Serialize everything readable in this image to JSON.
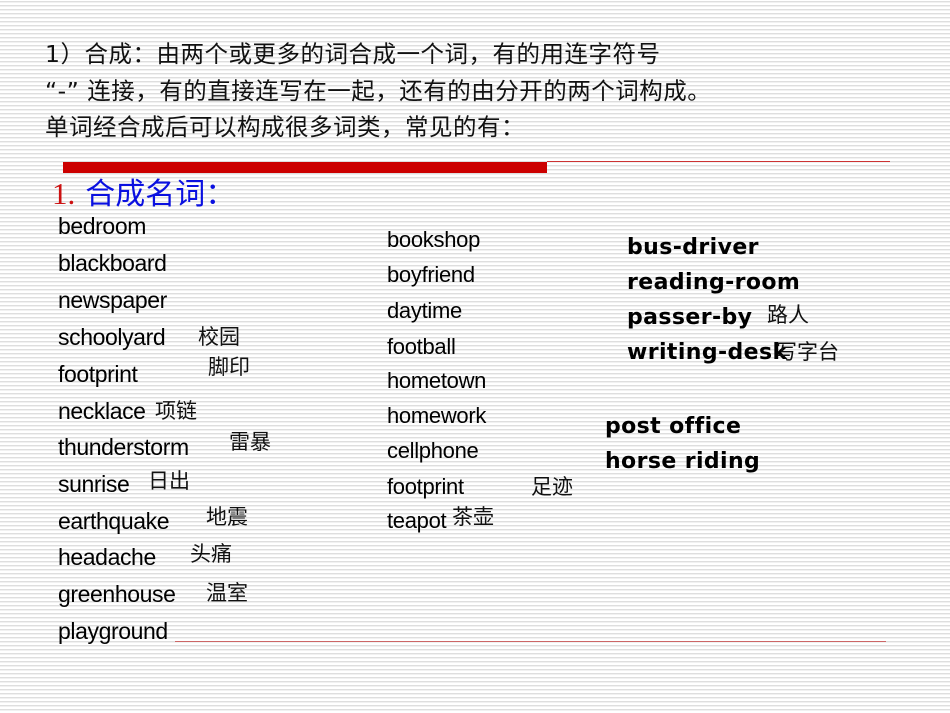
{
  "intro": {
    "line1": "1）合成：由两个或更多的词合成一个词，有的用连字符号",
    "line2": "“-” 连接，有的直接连写在一起，还有的由分开的两个词构成。",
    "line3": "单词经合成后可以构成很多词类，常见的有："
  },
  "section": {
    "number": "1.",
    "label": "合成名词："
  },
  "colors": {
    "accent_red": "#cc0000",
    "title_blue": "#0a10e0"
  },
  "column1": [
    {
      "word": "bedroom",
      "gloss": ""
    },
    {
      "word": "blackboard",
      "gloss": ""
    },
    {
      "word": "newspaper",
      "gloss": ""
    },
    {
      "word": "schoolyard",
      "gloss": "校园"
    },
    {
      "word": "footprint",
      "gloss": "脚印"
    },
    {
      "word": "necklace",
      "gloss": "项链"
    },
    {
      "word": "thunderstorm",
      "gloss": "雷暴"
    },
    {
      "word": "sunrise",
      "gloss": "日出"
    },
    {
      "word": "earthquake",
      "gloss": "地震"
    },
    {
      "word": "headache",
      "gloss": "头痛"
    },
    {
      "word": "greenhouse",
      "gloss": "温室"
    },
    {
      "word": "playground",
      "gloss": ""
    }
  ],
  "column2": [
    {
      "word": "bookshop",
      "gloss": ""
    },
    {
      "word": "boyfriend",
      "gloss": ""
    },
    {
      "word": "daytime",
      "gloss": ""
    },
    {
      "word": "football",
      "gloss": ""
    },
    {
      "word": "hometown",
      "gloss": ""
    },
    {
      "word": "homework",
      "gloss": ""
    },
    {
      "word": "cellphone",
      "gloss": ""
    },
    {
      "word": "footprint",
      "gloss": "足迹"
    },
    {
      "word": "teapot",
      "gloss": "茶壶"
    }
  ],
  "column3": [
    {
      "word": "bus-driver",
      "gloss": ""
    },
    {
      "word": "reading-room",
      "gloss": ""
    },
    {
      "word": "passer-by",
      "gloss": "路人"
    },
    {
      "word": "writing-desk",
      "gloss": "写字台"
    }
  ],
  "column4": [
    {
      "word": "post office"
    },
    {
      "word": "horse riding"
    }
  ]
}
